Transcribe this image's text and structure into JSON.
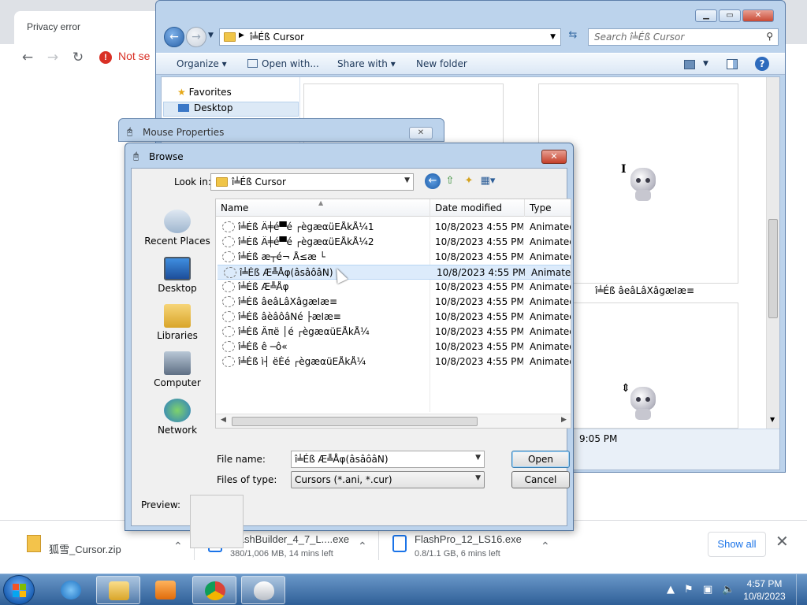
{
  "chrome": {
    "tab_title": "Privacy error",
    "not_secure": "Not se",
    "downloads": [
      {
        "name": "狐雪_Cursor.zip",
        "status": ""
      },
      {
        "name": "FlashBuilder_4_7_L....exe",
        "status": "380/1,006 MB, 14 mins left"
      },
      {
        "name": "FlashPro_12_LS16.exe",
        "status": "0.8/1.1 GB, 6 mins left"
      }
    ],
    "show_all": "Show all"
  },
  "explorer": {
    "path": "î╧Éß Cursor",
    "search_placeholder": "Search î╧Éß Cursor",
    "commands": {
      "organize": "Organize",
      "open_with": "Open with...",
      "share_with": "Share with",
      "new_folder": "New folder"
    },
    "nav": {
      "favorites": "Favorites",
      "desktop": "Desktop"
    },
    "tile_label": "î╧Éß âeâLâXâgæIæ≡",
    "status_time": "9:05 PM"
  },
  "mouse_properties": {
    "title": "Mouse Properties"
  },
  "browse": {
    "title": "Browse",
    "look_in_label": "Look in:",
    "look_in_value": "î╧Éß Cursor",
    "places": [
      "Recent Places",
      "Desktop",
      "Libraries",
      "Computer",
      "Network"
    ],
    "columns": {
      "name": "Name",
      "date": "Date modified",
      "type": "Type"
    },
    "files": [
      {
        "name": "î╧Éß Ä╪é▀é ┌ègæαüEÅkÅ¼1",
        "date": "10/8/2023 4:55 PM",
        "type": "Animated"
      },
      {
        "name": "î╧Éß Ä╪é▀é ┌ègæαüEÅkÅ¼2",
        "date": "10/8/2023 4:55 PM",
        "type": "Animated"
      },
      {
        "name": "î╧Éß æ┬é¬ Å≤æ └",
        "date": "10/8/2023 4:55 PM",
        "type": "Animated"
      },
      {
        "name": "î╧Éß Æ╩Åφ(âsâôâN)",
        "date": "10/8/2023 4:55 PM",
        "type": "Animated"
      },
      {
        "name": "î╧Éß Æ╩Åφ",
        "date": "10/8/2023 4:55 PM",
        "type": "Animated"
      },
      {
        "name": "î╧Éß âeâLâXâgæIæ≡",
        "date": "10/8/2023 4:55 PM",
        "type": "Animated"
      },
      {
        "name": "î╧Éß âèâôâNé ├æIæ≡",
        "date": "10/8/2023 4:55 PM",
        "type": "Animated"
      },
      {
        "name": "î╧Éß Âπë │é ┌ègæαüEÅkÅ¼",
        "date": "10/8/2023 4:55 PM",
        "type": "Animated"
      },
      {
        "name": "î╧Éß ê ─ô«",
        "date": "10/8/2023 4:55 PM",
        "type": "Animated"
      },
      {
        "name": "î╧Éß ì┤ ëÉé ┌ègæαüEÅkÅ¼",
        "date": "10/8/2023 4:55 PM",
        "type": "Animated"
      }
    ],
    "selected_index": 3,
    "file_name_label": "File name:",
    "file_name_value": "î╧Éß Æ╩Åφ(âsâôâN)",
    "file_type_label": "Files of type:",
    "file_type_value": "Cursors (*.ani, *.cur)",
    "open_label": "Open",
    "cancel_label": "Cancel",
    "preview_label": "Preview:"
  },
  "taskbar": {
    "time": "4:57 PM",
    "date": "10/8/2023"
  }
}
